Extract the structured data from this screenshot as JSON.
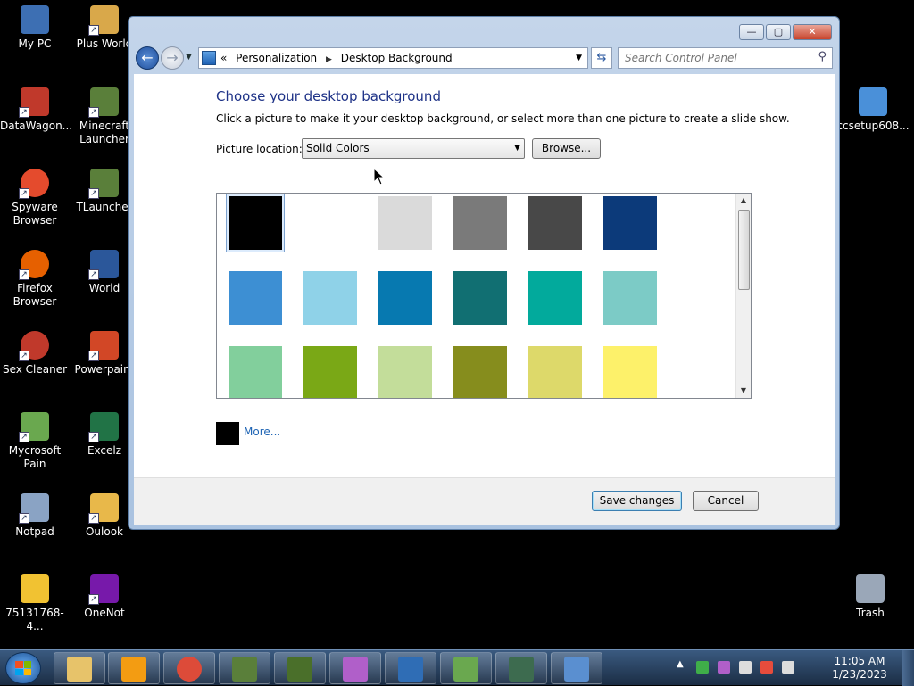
{
  "desktop": {
    "icons": [
      {
        "label": "My PC",
        "color": "#3d6fb3"
      },
      {
        "label": "Plus World",
        "color": "#d9a84a"
      },
      {
        "label": "DataWagon...",
        "color": "#c0392b"
      },
      {
        "label": "Minecraft Launcher",
        "color": "#5a7f3a"
      },
      {
        "label": "Spyware Browser",
        "color": "#e44b2d"
      },
      {
        "label": "TLauncher",
        "color": "#5a7f3a"
      },
      {
        "label": "Firefox Browser",
        "color": "#e66000"
      },
      {
        "label": "World",
        "color": "#2b579a"
      },
      {
        "label": "Sex Cleaner",
        "color": "#c0392b"
      },
      {
        "label": "Powerpaint",
        "color": "#d24726"
      },
      {
        "label": "Mycrosoft Pain",
        "color": "#6aa84f"
      },
      {
        "label": "Excelz",
        "color": "#217346"
      },
      {
        "label": "Notpad",
        "color": "#8aa3c4"
      },
      {
        "label": "Oulook",
        "color": "#e8b84a"
      },
      {
        "label": "75131768-4...",
        "color": "#f1c232"
      },
      {
        "label": "OneNot",
        "color": "#7719aa"
      },
      {
        "label": "ccsetup608...",
        "color": "#4a90d9"
      },
      {
        "label": "Trash",
        "color": "#9aa7b8"
      }
    ]
  },
  "window": {
    "nav": {
      "back_icon": "back-arrow-icon",
      "forward_icon": "forward-arrow-icon",
      "crumb_root": "«",
      "crumb_1": "Personalization",
      "crumb_2": "Desktop Background",
      "search_placeholder": "Search Control Panel"
    },
    "heading": "Choose your desktop background",
    "subtext": "Click a picture to make it your desktop background, or select more than one picture to create a slide show.",
    "location_label": "Picture location:",
    "location_value": "Solid Colors",
    "browse_label": "Browse...",
    "more_label": "More...",
    "more_color": "#000000",
    "save_label": "Save changes",
    "cancel_label": "Cancel"
  },
  "swatches": {
    "selected_index": 0,
    "colors": [
      "#000000",
      "#ffffff",
      "#dadada",
      "#7a7a7a",
      "#484848",
      "#0c3a7a",
      "#3d8fd3",
      "#8fd2e8",
      "#0779b0",
      "#116f72",
      "#02aa9c",
      "#7ccbc6",
      "#82cf9c",
      "#7aa816",
      "#c3dd9a",
      "#868d1d",
      "#ddd96a",
      "#fdf16a"
    ]
  },
  "taskbar": {
    "items": [
      {
        "name": "explorer",
        "color": "#e7c36a"
      },
      {
        "name": "media-player",
        "color": "#f39c12"
      },
      {
        "name": "chrome",
        "color": "#dd4b39"
      },
      {
        "name": "minecraft-1",
        "color": "#5a7f3a"
      },
      {
        "name": "minecraft-2",
        "color": "#4a6f2a"
      },
      {
        "name": "onenote",
        "color": "#b05fc9"
      },
      {
        "name": "eyes",
        "color": "#2f6db5"
      },
      {
        "name": "users",
        "color": "#6aa84f"
      },
      {
        "name": "remote",
        "color": "#3d6b4f"
      },
      {
        "name": "control-panel",
        "color": "#5a8fd0"
      }
    ],
    "time": "11:05 AM",
    "date": "1/23/2023"
  }
}
